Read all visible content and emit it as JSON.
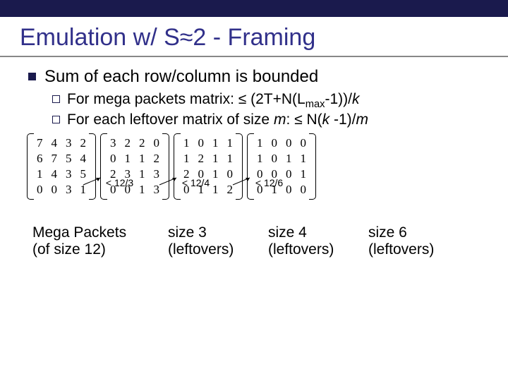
{
  "title": "Emulation w/ S≈2 - Framing",
  "bullet1": "Sum of each row/column is bounded",
  "sub1_pre": "For mega packets matrix: ≤ (2T+N(L",
  "sub1_sub": "max",
  "sub1_post": "-1))/",
  "sub1_k": "k",
  "sub2_pre": "For each leftover matrix of size ",
  "sub2_m1": "m",
  "sub2_mid": ": ≤ N(",
  "sub2_k": "k",
  "sub2_mid2": " -1)/",
  "sub2_m2": "m",
  "matrices": [
    [
      [
        7,
        4,
        3,
        2
      ],
      [
        6,
        7,
        5,
        4
      ],
      [
        1,
        4,
        3,
        5
      ],
      [
        0,
        0,
        3,
        1
      ]
    ],
    [
      [
        3,
        2,
        2,
        0
      ],
      [
        0,
        1,
        1,
        2
      ],
      [
        2,
        3,
        1,
        3
      ],
      [
        0,
        0,
        1,
        3
      ]
    ],
    [
      [
        1,
        0,
        1,
        1
      ],
      [
        1,
        2,
        1,
        1
      ],
      [
        2,
        0,
        1,
        0
      ],
      [
        0,
        1,
        1,
        2
      ]
    ],
    [
      [
        1,
        0,
        0,
        0
      ],
      [
        1,
        0,
        1,
        1
      ],
      [
        0,
        0,
        0,
        1
      ],
      [
        0,
        1,
        0,
        0
      ]
    ]
  ],
  "arrows": [
    "< 12/3",
    "< 12/4",
    "< 12/6"
  ],
  "captions": [
    {
      "l1": "Mega Packets",
      "l2": "(of size 12)"
    },
    {
      "l1": "size 3",
      "l2": "(leftovers)"
    },
    {
      "l1": "size 4",
      "l2": "(leftovers)"
    },
    {
      "l1": "size 6",
      "l2": "(leftovers)"
    }
  ]
}
